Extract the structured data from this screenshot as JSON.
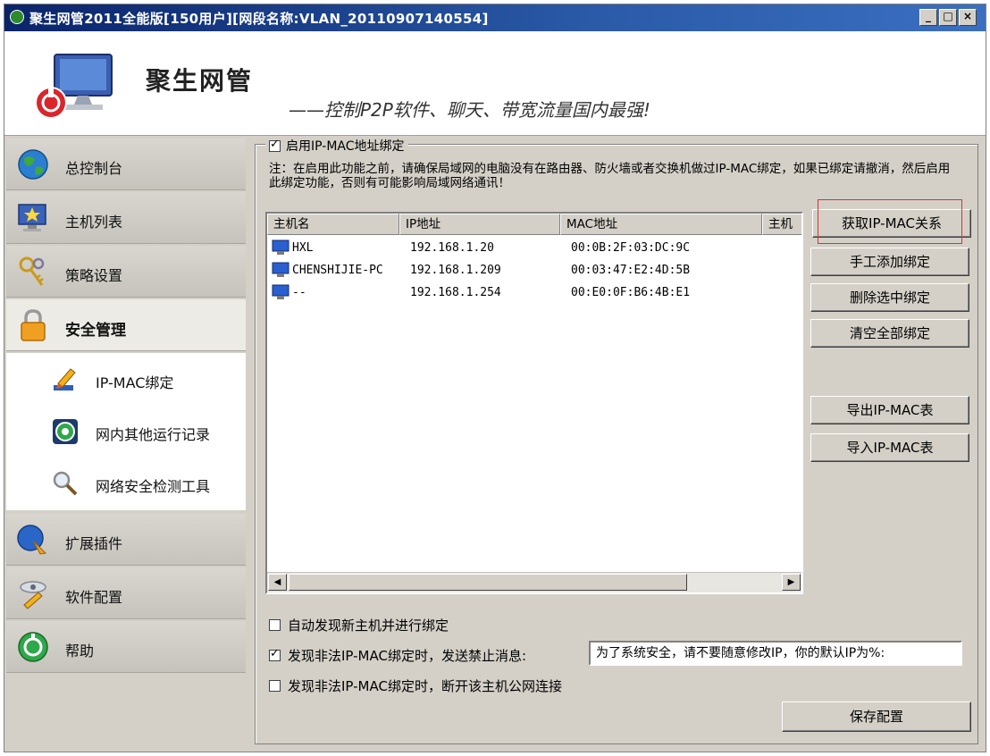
{
  "window": {
    "title": "聚生网管2011全能版[150用户][网段名称:VLAN_20110907140554]",
    "minimize": "_",
    "maximize": "□",
    "close": "×"
  },
  "header": {
    "brand": "聚生网管",
    "slogan": "——控制P2P软件、聊天、带宽流量国内最强!"
  },
  "sidebar": {
    "items": [
      {
        "label": "总控制台",
        "icon": "globe-icon"
      },
      {
        "label": "主机列表",
        "icon": "monitor-star-icon"
      },
      {
        "label": "策略设置",
        "icon": "keys-icon"
      },
      {
        "label": "安全管理",
        "icon": "lock-icon",
        "active": true
      },
      {
        "label": "扩展插件",
        "icon": "plugin-icon"
      },
      {
        "label": "软件配置",
        "icon": "config-icon"
      },
      {
        "label": "帮助",
        "icon": "help-icon"
      }
    ],
    "subitems": [
      {
        "label": "IP-MAC绑定",
        "icon": "pencil-icon"
      },
      {
        "label": "网内其他运行记录",
        "icon": "record-icon"
      },
      {
        "label": "网络安全检测工具",
        "icon": "magnifier-icon"
      }
    ]
  },
  "binding": {
    "enable_label": "启用IP-MAC地址绑定",
    "enabled": true,
    "note": "注：在启用此功能之前，请确保局域网的电脑没有在路由器、防火墙或者交换机做过IP-MAC绑定，如果已绑定请撤消，然后启用此绑定功能，否则有可能影响局域网络通讯！",
    "columns": [
      "主机名",
      "IP地址",
      "MAC地址",
      "主机"
    ],
    "rows": [
      {
        "host": "HXL",
        "ip": "192.168.1.20",
        "mac": "00:0B:2F:03:DC:9C"
      },
      {
        "host": "CHENSHIJIE-PC",
        "ip": "192.168.1.209",
        "mac": "00:03:47:E2:4D:5B"
      },
      {
        "host": "--",
        "ip": "192.168.1.254",
        "mac": "00:E0:0F:B6:4B:E1"
      }
    ],
    "scroll_left": "◀",
    "scroll_right": "▶"
  },
  "buttons": {
    "fetch": "获取IP-MAC关系",
    "manual_add": "手工添加绑定",
    "delete_selected": "删除选中绑定",
    "clear_all": "清空全部绑定",
    "export": "导出IP-MAC表",
    "import": "导入IP-MAC表",
    "save": "保存配置"
  },
  "options": {
    "auto_discover": {
      "label": "自动发现新主机并进行绑定",
      "checked": false
    },
    "send_message": {
      "label": "发现非法IP-MAC绑定时，发送禁止消息:",
      "checked": true
    },
    "message_text": "为了系统安全，请不要随意修改IP，你的默认IP为%:",
    "disconnect": {
      "label": "发现非法IP-MAC绑定时，断开该主机公网连接",
      "checked": false
    }
  }
}
